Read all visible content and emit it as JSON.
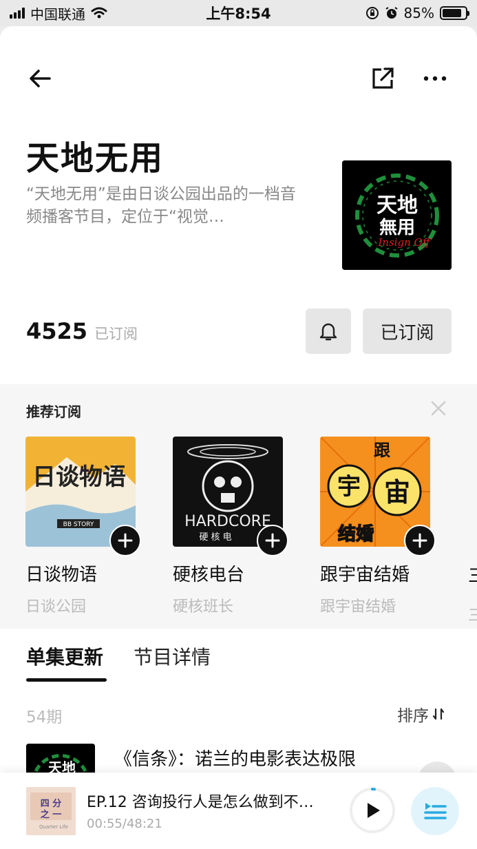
{
  "status": {
    "carrier": "中国联通",
    "time": "上午8:54",
    "battery": "85%",
    "battery_level": 0.85
  },
  "podcast": {
    "title": "天地无用",
    "description": "“天地无用”是由日谈公园出品的一档音频播客节目，定位于“视觉…",
    "subscriber_count": "4525",
    "subscriber_label": "已订阅",
    "subscribe_button": "已订阅"
  },
  "recommend": {
    "title": "推荐订阅",
    "items": [
      {
        "name": "日谈物语",
        "author": "日谈公园",
        "cover_text": "日谈物语",
        "cover_sub": "BB STORY"
      },
      {
        "name": "硬核电台",
        "author": "硬核班长",
        "cover_text": "HARDCORE",
        "cover_sub": "硬 核 电"
      },
      {
        "name": "跟宇宙结婚",
        "author": "跟宇宙结婚",
        "cover_text": "宇",
        "cover_sub": "宙"
      }
    ],
    "edge_name": "三",
    "edge_author": "三"
  },
  "tabs": [
    {
      "label": "单集更新",
      "active": true
    },
    {
      "label": "节目详情",
      "active": false
    }
  ],
  "episodes": {
    "count_label": "54期",
    "sort_label": "排序",
    "first_title": "《信条》：诺兰的电影表达极限"
  },
  "player": {
    "title": "EP.12 咨询投行人是怎么做到不…",
    "time": "00:55/48:21"
  },
  "colors": {
    "accent": "#29a9e0",
    "orange": "#f5901e",
    "cream": "#f2b233"
  },
  "icons": {
    "back": "back-arrow-icon",
    "share": "share-icon",
    "more": "more-icon",
    "bell": "bell-icon",
    "close": "close-icon",
    "add": "plus-icon",
    "sort": "sort-icon",
    "play": "play-icon",
    "playlist": "playlist-icon"
  }
}
